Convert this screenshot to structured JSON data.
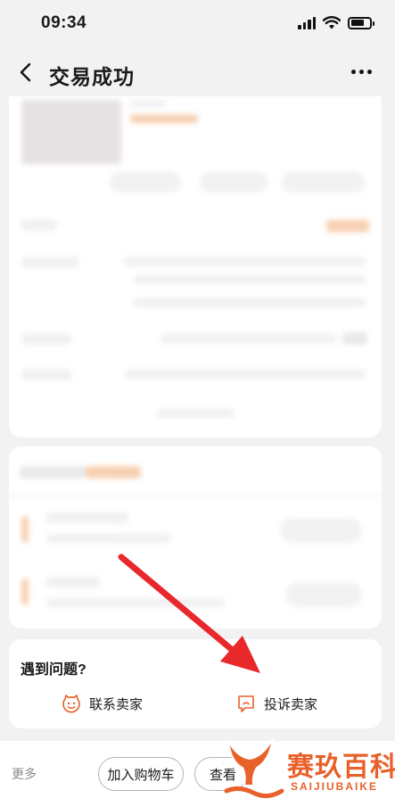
{
  "status_bar": {
    "time": "09:34"
  },
  "nav": {
    "title": "交易成功"
  },
  "issue_section": {
    "title": "遇到问题?",
    "contact_seller": "联系卖家",
    "complain_seller": "投诉卖家"
  },
  "bottom_bar": {
    "more_label": "更多",
    "add_to_cart": "加入购物车",
    "second_button": "查看"
  },
  "watermark": {
    "name": "赛玖百科",
    "pinyin": "SAIJIUBAIKE"
  },
  "colors": {
    "accent_orange": "#e8612a",
    "annotation_arrow": "#e8282b"
  },
  "icons": {
    "contact": "smiley-face-icon",
    "complain": "chat-bubble-icon"
  }
}
